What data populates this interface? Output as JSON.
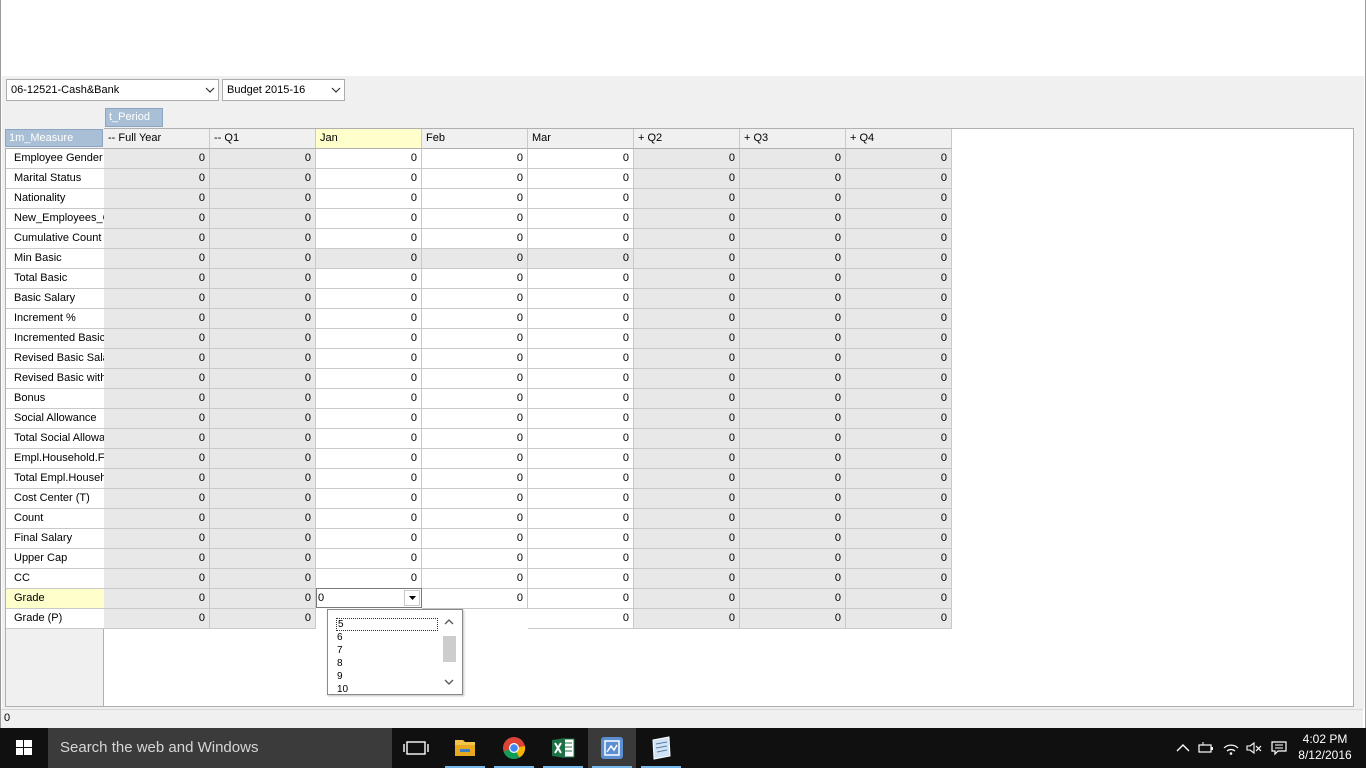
{
  "toolbar": {
    "account_combo": "06-12521-Cash&Bank",
    "budget_combo": "Budget 2015-16"
  },
  "pivot": {
    "column_field": "t_Period",
    "row_field": "1m_Measure",
    "columns": [
      "-- Full Year",
      "-- Q1",
      "Jan",
      "Feb",
      "Mar",
      "+ Q2",
      "+ Q3",
      "+ Q4"
    ],
    "rows": [
      {
        "label": "Employee Gender",
        "values": [
          "0",
          "0",
          "0",
          "0",
          "0",
          "0",
          "0",
          "0"
        ]
      },
      {
        "label": "Marital Status",
        "values": [
          "0",
          "0",
          "0",
          "0",
          "0",
          "0",
          "0",
          "0"
        ]
      },
      {
        "label": "Nationality",
        "values": [
          "0",
          "0",
          "0",
          "0",
          "0",
          "0",
          "0",
          "0"
        ]
      },
      {
        "label": "New_Employees_C",
        "values": [
          "0",
          "0",
          "0",
          "0",
          "0",
          "0",
          "0",
          "0"
        ]
      },
      {
        "label": "Cumulative Count",
        "values": [
          "0",
          "0",
          "0",
          "0",
          "0",
          "0",
          "0",
          "0"
        ]
      },
      {
        "label": "Min Basic",
        "values": [
          "0",
          "0",
          "0",
          "0",
          "0",
          "0",
          "0",
          "0"
        ]
      },
      {
        "label": "Total Basic",
        "values": [
          "0",
          "0",
          "0",
          "0",
          "0",
          "0",
          "0",
          "0"
        ]
      },
      {
        "label": "Basic Salary",
        "values": [
          "0",
          "0",
          "0",
          "0",
          "0",
          "0",
          "0",
          "0"
        ]
      },
      {
        "label": "Increment %",
        "values": [
          "0",
          "0",
          "0",
          "0",
          "0",
          "0",
          "0",
          "0"
        ]
      },
      {
        "label": "Incremented  Basic",
        "values": [
          "0",
          "0",
          "0",
          "0",
          "0",
          "0",
          "0",
          "0"
        ]
      },
      {
        "label": "Revised Basic Sala",
        "values": [
          "0",
          "0",
          "0",
          "0",
          "0",
          "0",
          "0",
          "0"
        ]
      },
      {
        "label": "Revised Basic with",
        "values": [
          "0",
          "0",
          "0",
          "0",
          "0",
          "0",
          "0",
          "0"
        ]
      },
      {
        "label": "Bonus",
        "values": [
          "0",
          "0",
          "0",
          "0",
          "0",
          "0",
          "0",
          "0"
        ]
      },
      {
        "label": "Social Allowance",
        "values": [
          "0",
          "0",
          "0",
          "0",
          "0",
          "0",
          "0",
          "0"
        ]
      },
      {
        "label": "Total Social Allowa",
        "values": [
          "0",
          "0",
          "0",
          "0",
          "0",
          "0",
          "0",
          "0"
        ]
      },
      {
        "label": "Empl.Household.Fu",
        "values": [
          "0",
          "0",
          "0",
          "0",
          "0",
          "0",
          "0",
          "0"
        ]
      },
      {
        "label": "Total Empl.Househ",
        "values": [
          "0",
          "0",
          "0",
          "0",
          "0",
          "0",
          "0",
          "0"
        ]
      },
      {
        "label": "Cost Center (T)",
        "values": [
          "0",
          "0",
          "0",
          "0",
          "0",
          "0",
          "0",
          "0"
        ]
      },
      {
        "label": "Count",
        "values": [
          "0",
          "0",
          "0",
          "0",
          "0",
          "0",
          "0",
          "0"
        ]
      },
      {
        "label": "Final Salary",
        "values": [
          "0",
          "0",
          "0",
          "0",
          "0",
          "0",
          "0",
          "0"
        ]
      },
      {
        "label": "Upper Cap",
        "values": [
          "0",
          "0",
          "0",
          "0",
          "0",
          "0",
          "0",
          "0"
        ]
      },
      {
        "label": "CC",
        "values": [
          "0",
          "0",
          "0",
          "0",
          "0",
          "0",
          "0",
          "0"
        ]
      },
      {
        "label": "Grade",
        "values": [
          "0",
          "0",
          "",
          "0",
          "0",
          "0",
          "0",
          "0"
        ]
      },
      {
        "label": "Grade (P)",
        "values": [
          "0",
          "0",
          "",
          "",
          "0",
          "0",
          "0",
          "0"
        ]
      }
    ],
    "selected_row": "Grade",
    "selected_column": "Jan"
  },
  "editor": {
    "value": "0",
    "options": [
      "5",
      "6",
      "7",
      "8",
      "9",
      "10"
    ],
    "focused_option": "5"
  },
  "status": {
    "text": "0"
  },
  "taskbar": {
    "search_placeholder": "Search the web and Windows",
    "time": "4:02 PM",
    "date": "8/12/2016",
    "accent_color": "#76b9ed"
  }
}
